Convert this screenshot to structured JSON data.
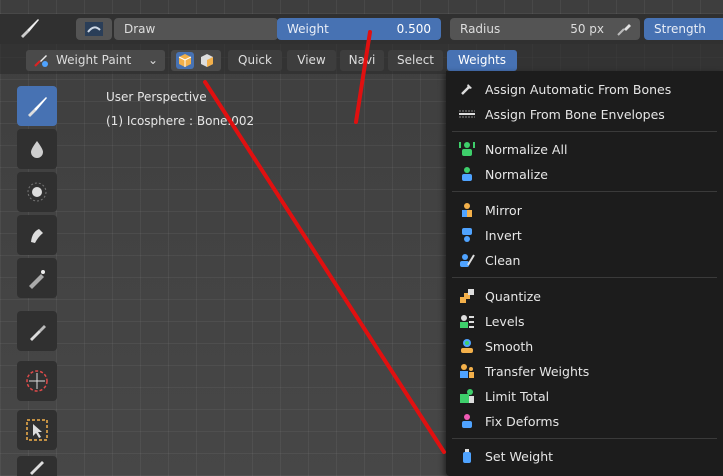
{
  "topbar": {
    "mode_label": "Draw",
    "weight_label": "Weight",
    "weight_value": "0.500",
    "radius_label": "Radius",
    "radius_value": "50 px",
    "strength_label": "Strength"
  },
  "header": {
    "mode_select": "Weight Paint",
    "menus": [
      "Quick",
      "View",
      "Navi",
      "Select",
      "Weights"
    ]
  },
  "viewport": {
    "perspective": "User Perspective",
    "object": "(1) Icosphere : Bone.002"
  },
  "weights_menu": {
    "items": [
      {
        "label": "Assign Automatic From Bones",
        "icon": "bone-icon"
      },
      {
        "label": "Assign From Bone Envelopes",
        "icon": "envelope-icon"
      },
      {
        "label": "Normalize All",
        "icon": "normalize-all-icon"
      },
      {
        "label": "Normalize",
        "icon": "normalize-icon"
      },
      {
        "label": "Mirror",
        "icon": "mirror-icon"
      },
      {
        "label": "Invert",
        "icon": "invert-icon"
      },
      {
        "label": "Clean",
        "icon": "clean-icon"
      },
      {
        "label": "Quantize",
        "icon": "quantize-icon"
      },
      {
        "label": "Levels",
        "icon": "levels-icon"
      },
      {
        "label": "Smooth",
        "icon": "smooth-icon"
      },
      {
        "label": "Transfer Weights",
        "icon": "transfer-icon"
      },
      {
        "label": "Limit Total",
        "icon": "limit-icon"
      },
      {
        "label": "Fix Deforms",
        "icon": "fix-deforms-icon"
      },
      {
        "label": "Set Weight",
        "icon": "set-weight-icon"
      }
    ]
  },
  "colors": {
    "accent": "#4772b3",
    "menu_bg": "#1c1c1c",
    "annotation": "#e01010"
  }
}
